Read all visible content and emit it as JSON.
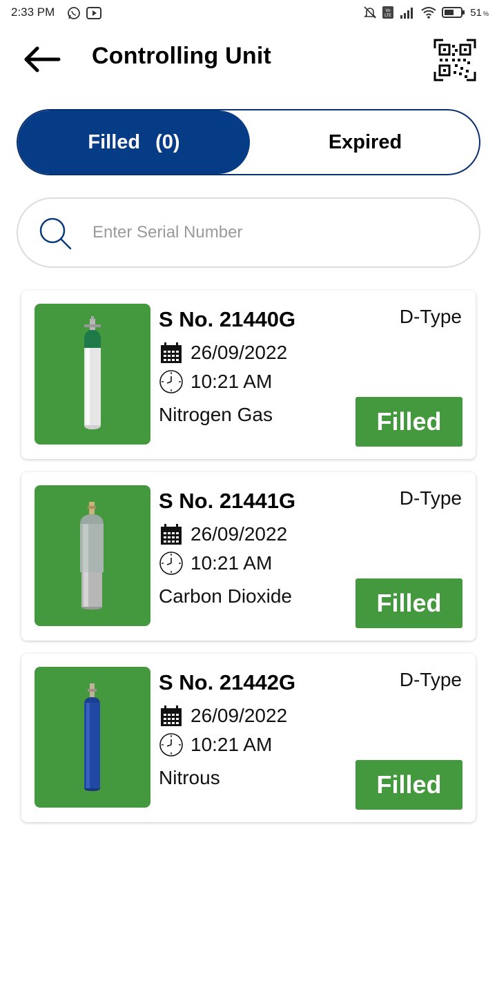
{
  "status_bar": {
    "time": "2:33 PM",
    "battery": "51",
    "battery_unit": "%",
    "icons": [
      "whatsapp-icon",
      "youtube-icon",
      "mute-icon",
      "volte-icon",
      "signal-icon",
      "wifi-icon",
      "battery-icon"
    ]
  },
  "header": {
    "title": "Controlling Unit",
    "back_icon": "back-arrow-icon",
    "qr_icon": "qr-code-icon"
  },
  "tabs": {
    "filled_label": "Filled",
    "filled_count": "(0)",
    "expired_label": "Expired",
    "active": "filled"
  },
  "search": {
    "placeholder": "Enter Serial Number",
    "value": ""
  },
  "cylinders": [
    {
      "serial": "S No. 21440G",
      "type": "D-Type",
      "date": "26/09/2022",
      "time": "10:21 AM",
      "gas": "Nitrogen Gas",
      "status": "Filled",
      "cylinder_icon": "nitrogen-cylinder-image"
    },
    {
      "serial": "S No. 21441G",
      "type": "D-Type",
      "date": "26/09/2022",
      "time": "10:21 AM",
      "gas": "Carbon Dioxide",
      "status": "Filled",
      "cylinder_icon": "co2-cylinder-image"
    },
    {
      "serial": "S No. 21442G",
      "type": "D-Type",
      "date": "26/09/2022",
      "time": "10:21 AM",
      "gas": "Nitrous",
      "status": "Filled",
      "cylinder_icon": "nitrous-cylinder-image"
    }
  ],
  "colors": {
    "primary_blue": "#063b86",
    "status_green": "#44983d"
  }
}
